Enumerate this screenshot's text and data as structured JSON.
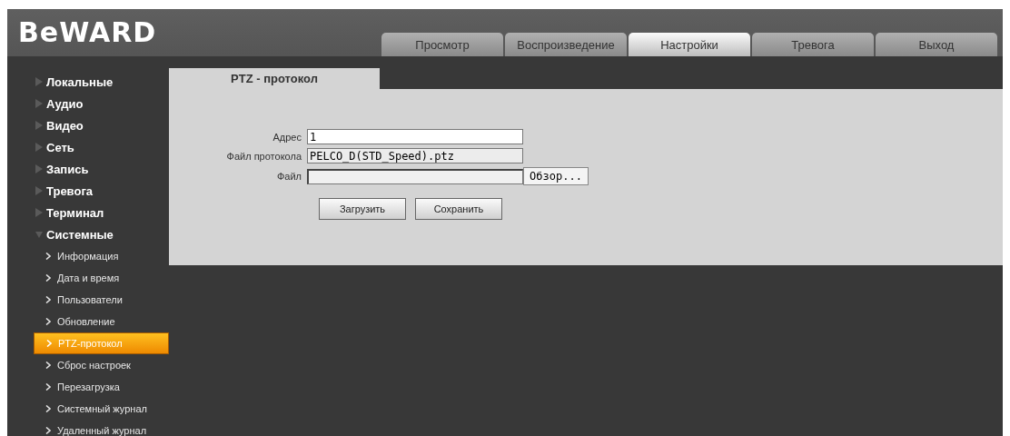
{
  "logo": "BeWARD",
  "tabs": [
    {
      "label": "Просмотр",
      "selected": false
    },
    {
      "label": "Воспроизведение",
      "selected": false
    },
    {
      "label": "Настройки",
      "selected": true
    },
    {
      "label": "Тревога",
      "selected": false
    },
    {
      "label": "Выход",
      "selected": false
    }
  ],
  "sidebar": {
    "items": [
      {
        "kind": "section",
        "label": "Локальные",
        "expanded": false
      },
      {
        "kind": "section",
        "label": "Аудио",
        "expanded": false
      },
      {
        "kind": "section",
        "label": "Видео",
        "expanded": false
      },
      {
        "kind": "section",
        "label": "Сеть",
        "expanded": false
      },
      {
        "kind": "section",
        "label": "Запись",
        "expanded": false
      },
      {
        "kind": "section",
        "label": "Тревога",
        "expanded": false
      },
      {
        "kind": "section",
        "label": "Терминал",
        "expanded": false
      },
      {
        "kind": "section",
        "label": "Системные",
        "expanded": true,
        "children": [
          {
            "label": "Информация",
            "selected": false
          },
          {
            "label": "Дата и время",
            "selected": false
          },
          {
            "label": "Пользователи",
            "selected": false
          },
          {
            "label": "Обновление",
            "selected": false
          },
          {
            "label": "PTZ-протокол",
            "selected": true
          },
          {
            "label": "Сброс настроек",
            "selected": false
          },
          {
            "label": "Перезагрузка",
            "selected": false
          },
          {
            "label": "Системный журнал",
            "selected": false
          },
          {
            "label": "Удаленный журнал",
            "selected": false
          }
        ]
      }
    ]
  },
  "panel": {
    "title": "PTZ - протокол",
    "fields": [
      {
        "kind": "text",
        "label": "Адрес",
        "value": "1"
      },
      {
        "kind": "readonly",
        "label": "Файл протокола",
        "value": "PELCO_D(STD_Speed).ptz"
      },
      {
        "kind": "file",
        "label": "Файл",
        "button": "Обзор..."
      }
    ],
    "buttons": [
      "Загрузить",
      "Сохранить"
    ]
  }
}
